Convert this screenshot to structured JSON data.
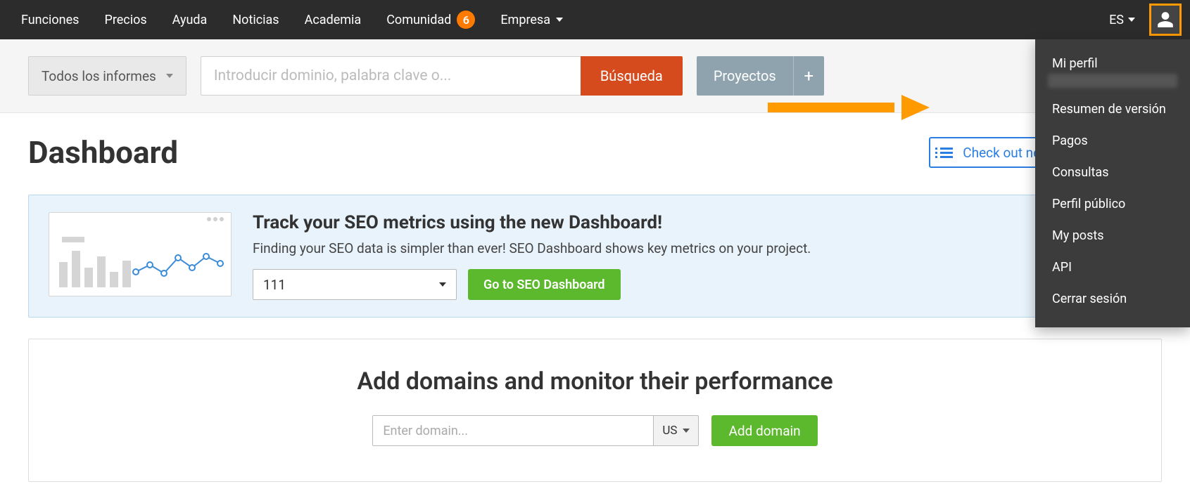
{
  "nav": {
    "items": [
      "Funciones",
      "Precios",
      "Ayuda",
      "Noticias",
      "Academia",
      "Comunidad",
      "Empresa"
    ],
    "community_badge": "6",
    "lang": "ES"
  },
  "user_menu": {
    "profile": "Mi perfil",
    "items": [
      "Resumen de versión",
      "Pagos",
      "Consultas",
      "Perfil público",
      "My posts",
      "API",
      "Cerrar sesión"
    ]
  },
  "searchbar": {
    "reports_label": "Todos los informes",
    "search_placeholder": "Introducir dominio, palabra clave o...",
    "search_btn": "Búsqueda",
    "projects_btn": "Proyectos"
  },
  "main": {
    "title": "Dashboard",
    "new_dash_link": "Check out new SEO Dashboard"
  },
  "promo": {
    "heading": "Track your SEO metrics using the new Dashboard!",
    "sub": "Finding your SEO data is simpler than ever! SEO Dashboard shows key metrics on your project.",
    "select_value": "111",
    "go_btn": "Go to SEO Dashboard"
  },
  "addcard": {
    "heading": "Add domains and monitor their performance",
    "domain_placeholder": "Enter domain...",
    "region": "US",
    "add_btn": "Add domain"
  }
}
